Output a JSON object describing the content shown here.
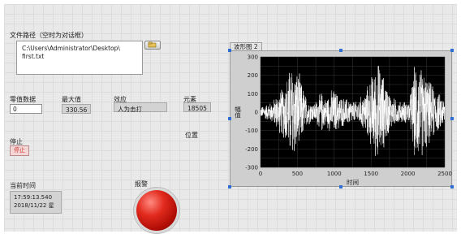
{
  "labels": {
    "file_path": "文件路径（空时为对话框）",
    "sample": "零值数据",
    "max": "最大值",
    "effect": "效应",
    "element": "元素",
    "position": "位置",
    "stop": "停止",
    "current_time": "当前时间",
    "alarm": "报警"
  },
  "values": {
    "path_line1": "C:\\Users\\Administrator\\Desktop\\",
    "path_line2": "first.txt",
    "sample": "0",
    "max": "330.56",
    "effect": "人为击打",
    "element": "18505",
    "stop_button": "停止",
    "time_line1": "17:59:13.540",
    "time_line2": "2018/11/22 星"
  },
  "colors": {
    "panel": "#e9e9e9",
    "plot_bg": "#000000",
    "signal": "#ffffff",
    "alarm": "#d11a10",
    "selection": "#2f6fd4"
  },
  "icons": {
    "browse": "folder-browse-icon"
  },
  "chart_data": {
    "type": "line",
    "title": "波形图 2",
    "xlabel": "时间",
    "ylabel": "幅值",
    "xlim": [
      0,
      2500
    ],
    "ylim": [
      -300,
      300
    ],
    "xticks": [
      0,
      500,
      1000,
      1500,
      2000,
      2500
    ],
    "yticks": [
      300,
      200,
      100,
      0,
      -100,
      -200,
      -300
    ],
    "grid": true,
    "series": [
      {
        "envelope": [
          [
            0,
            30
          ],
          [
            150,
            60
          ],
          [
            320,
            160
          ],
          [
            420,
            300
          ],
          [
            520,
            230
          ],
          [
            620,
            90
          ],
          [
            720,
            50
          ],
          [
            830,
            120
          ],
          [
            880,
            80
          ],
          [
            980,
            140
          ],
          [
            1100,
            90
          ],
          [
            1180,
            80
          ],
          [
            1300,
            60
          ],
          [
            1420,
            120
          ],
          [
            1520,
            230
          ],
          [
            1600,
            300
          ],
          [
            1700,
            180
          ],
          [
            1780,
            90
          ],
          [
            1900,
            60
          ],
          [
            2020,
            70
          ],
          [
            2100,
            300
          ],
          [
            2200,
            260
          ],
          [
            2300,
            180
          ],
          [
            2400,
            120
          ],
          [
            2500,
            80
          ]
        ]
      }
    ]
  }
}
